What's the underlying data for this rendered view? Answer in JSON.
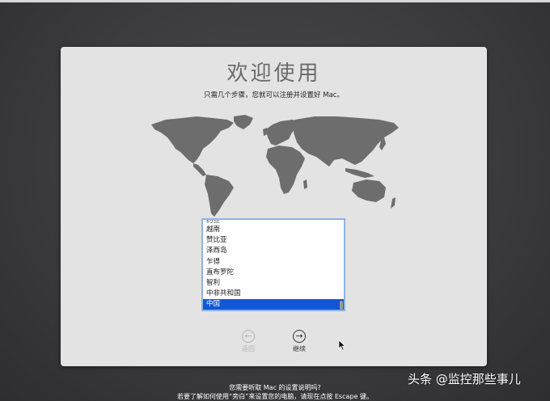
{
  "welcome": {
    "title": "欢迎使用",
    "subtitle": "只需几个步骤，您就可以注册并设置好 Mac。"
  },
  "country_list": {
    "items": [
      {
        "label": "约旦",
        "partial": true
      },
      {
        "label": "越南"
      },
      {
        "label": "赞比亚"
      },
      {
        "label": "泽西岛"
      },
      {
        "label": "乍得"
      },
      {
        "label": "直布罗陀"
      },
      {
        "label": "智利"
      },
      {
        "label": "中非共和国"
      },
      {
        "label": "中国",
        "selected": true
      }
    ],
    "selected_color": "#1257d6"
  },
  "nav": {
    "back_label": "返回",
    "back_icon": "arrow-left-circle-icon",
    "back_enabled": false,
    "continue_label": "继续",
    "continue_icon": "arrow-right-circle-icon"
  },
  "footer": {
    "line1": "您需要听取 Mac 的设置说明吗?",
    "line2": "若要了解如何使用“旁白”来设置您的电脑，请现在点按 Escape 键。"
  },
  "watermark": "头条 @监控那些事儿"
}
